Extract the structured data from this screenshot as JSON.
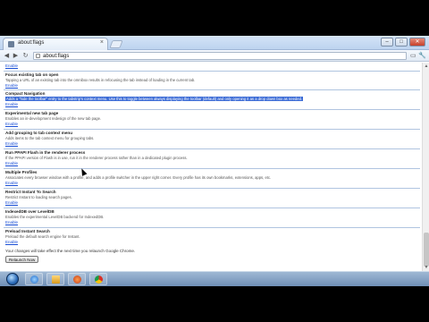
{
  "browser": {
    "tab_title": "about:flags",
    "tab_close": "×",
    "url": "about:flags",
    "controls": {
      "minimize": "–",
      "maximize": "□",
      "close": "✕"
    },
    "nav": {
      "back": "◀",
      "forward": "▶",
      "reload": "↻"
    },
    "toolbar_right": {
      "page_menu": "▭",
      "wrench": "🔧"
    }
  },
  "page": {
    "top_enable": "Enable",
    "experiments": [
      {
        "name": "Focus existing tab on open",
        "description": "Tapping a URL of an existing tab into the omnibox results in refocusing the tab instead of loading in the current tab.",
        "link": "Enable",
        "selected": false
      },
      {
        "name": "Compact Navigation",
        "description": "Adds a \"hide the toolbar\" entry to the tabstrip's context menu. Use this to toggle between always displaying the toolbar (default) and only opening it as a drop down box as needed.",
        "link": "Enable",
        "selected": true
      },
      {
        "name": "Experimental new tab page",
        "description": "Enables an in-development redesign of the new tab page.",
        "link": "Enable",
        "selected": false
      },
      {
        "name": "Add grouping to tab context menu",
        "description": "Adds items to the tab context menu for grouping tabs.",
        "link": "Enable",
        "selected": false
      },
      {
        "name": "Run PPAPI Flash in the renderer process",
        "description": "If the PPAPI version of Flash is in use, run it in the renderer process rather than in a dedicated plugin process.",
        "link": "Enable",
        "selected": false
      },
      {
        "name": "Multiple Profiles",
        "description": "Associates every browser window with a profile, and adds a profile switcher in the upper right corner. Every profile has its own bookmarks, extensions, apps, etc.",
        "link": "Enable",
        "selected": false
      },
      {
        "name": "Restrict Instant To Search",
        "description": "Restrict Instant to loading search pages.",
        "link": "Enable",
        "selected": false
      },
      {
        "name": "IndexedDB over LevelDB",
        "description": "Enables the experimental LevelDB backend for IndexedDB.",
        "link": "Enable",
        "selected": false
      },
      {
        "name": "Preload Instant Search",
        "description": "Preload the default search engine for Instant.",
        "link": "Enable",
        "selected": false
      }
    ],
    "footer_text": "Your changes will take effect the next time you relaunch Google Chrome.",
    "relaunch_label": "Relaunch Now"
  },
  "taskbar": {
    "tray_time": "",
    "items": [
      "internet-explorer",
      "folder",
      "media-player",
      "chrome"
    ]
  }
}
